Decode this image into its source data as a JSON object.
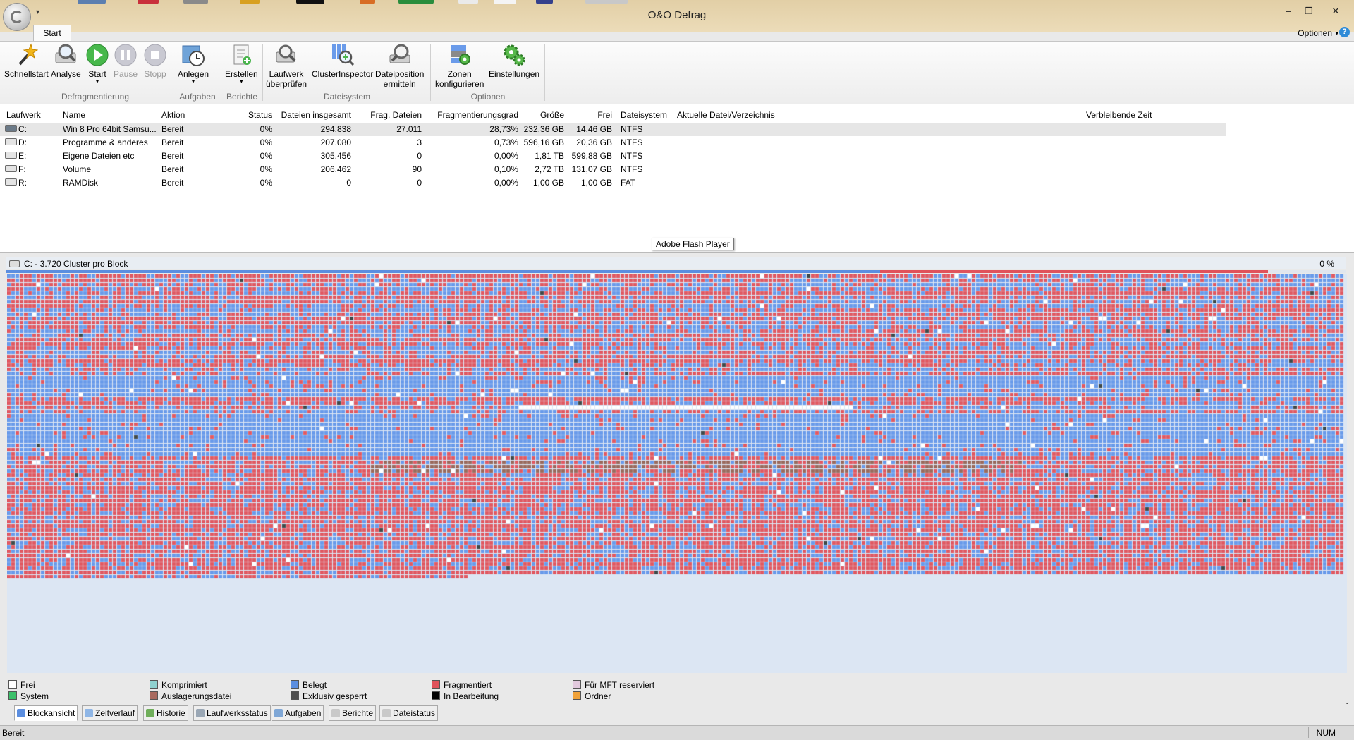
{
  "window": {
    "title": "O&O Defrag",
    "tab_start": "Start",
    "optionen": "Optionen",
    "help": "?",
    "minimize": "–",
    "restore": "❐",
    "close": "✕"
  },
  "ribbon": {
    "buttons": [
      {
        "label": "Schnellstart",
        "icon": "wand-icon"
      },
      {
        "label": "Analyse",
        "icon": "magnifier-icon"
      },
      {
        "label": "Start",
        "icon": "play-icon"
      },
      {
        "label": "Pause",
        "icon": "pause-icon",
        "disabled": true
      },
      {
        "label": "Stopp",
        "icon": "stop-icon",
        "disabled": true
      },
      {
        "label": "Anlegen",
        "icon": "clock-icon"
      },
      {
        "label": "Erstellen",
        "icon": "report-icon"
      },
      {
        "label": "Laufwerk überprüfen",
        "line1": "Laufwerk",
        "line2": "überprüfen",
        "icon": "drive-check-icon"
      },
      {
        "label": "ClusterInspector",
        "icon": "cluster-inspector-icon"
      },
      {
        "label": "Dateiposition ermitteln",
        "line1": "Dateiposition",
        "line2": "ermitteln",
        "icon": "file-search-icon"
      },
      {
        "label": "Zonen konfigurieren",
        "line1": "Zonen",
        "line2": "konfigurieren",
        "icon": "zones-icon"
      },
      {
        "label": "Einstellungen",
        "icon": "gears-icon"
      }
    ],
    "groups": [
      "Defragmentierung",
      "Aufgaben",
      "Berichte",
      "Dateisystem",
      "Optionen"
    ],
    "dropdown_glyph": "▾"
  },
  "drive_list": {
    "columns": [
      "Laufwerk",
      "Name",
      "Aktion",
      "Status",
      "Dateien insgesamt",
      "Frag. Dateien",
      "Fragmentierungsgrad",
      "Größe",
      "Frei",
      "Dateisystem",
      "Aktuelle Datei/Verzeichnis",
      "Verbleibende Zeit"
    ],
    "rows": [
      {
        "drive": "C:",
        "name": "Win 8 Pro 64bit Samsu...",
        "action": "Bereit",
        "status": "0%",
        "files": "294.838",
        "frag": "27.011",
        "degree": "28,73%",
        "size": "232,36 GB",
        "free": "14,46 GB",
        "fs": "NTFS",
        "selected": true
      },
      {
        "drive": "D:",
        "name": "Programme & anderes",
        "action": "Bereit",
        "status": "0%",
        "files": "207.080",
        "frag": "3",
        "degree": "0,73%",
        "size": "596,16 GB",
        "free": "20,36 GB",
        "fs": "NTFS"
      },
      {
        "drive": "E:",
        "name": "Eigene Dateien etc",
        "action": "Bereit",
        "status": "0%",
        "files": "305.456",
        "frag": "0",
        "degree": "0,00%",
        "size": "1,81 TB",
        "free": "599,88 GB",
        "fs": "NTFS"
      },
      {
        "drive": "F:",
        "name": "Volume",
        "action": "Bereit",
        "status": "0%",
        "files": "206.462",
        "frag": "90",
        "degree": "0,10%",
        "size": "2,72 TB",
        "free": "131,07 GB",
        "fs": "NTFS"
      },
      {
        "drive": "R:",
        "name": "RAMDisk",
        "action": "Bereit",
        "status": "0%",
        "files": "0",
        "frag": "0",
        "degree": "0,00%",
        "size": "1,00 GB",
        "free": "1,00 GB",
        "fs": "FAT"
      }
    ]
  },
  "tooltip": "Adobe Flash Player",
  "block_view": {
    "title": "C: - 3.720 Cluster pro Block",
    "percent": "0 %",
    "colors": {
      "fragmented": "#e05a63",
      "allocated": "#6a9bea",
      "free": "#ffffff",
      "system": "#9a6b5e",
      "locked": "#404a4a",
      "background": "#dce6f3"
    }
  },
  "legend": [
    {
      "label": "Frei",
      "color": "#ffffff"
    },
    {
      "label": "System",
      "color": "#3cc06a"
    },
    {
      "label": "Komprimiert",
      "color": "#8ed1cf"
    },
    {
      "label": "Auslagerungsdatei",
      "color": "#a8695e"
    },
    {
      "label": "Belegt",
      "color": "#5b8ee0"
    },
    {
      "label": "Exklusiv gesperrt",
      "color": "#4f4f4f"
    },
    {
      "label": "Fragmentiert",
      "color": "#e0525b"
    },
    {
      "label": "In Bearbeitung",
      "color": "#000000"
    },
    {
      "label": "Für MFT reserviert",
      "color": "#e2c9dd"
    },
    {
      "label": "Ordner",
      "color": "#f0a23a"
    }
  ],
  "bottom_tabs": [
    {
      "label": "Blockansicht",
      "icon": "grid-icon"
    },
    {
      "label": "Zeitverlauf",
      "icon": "chart-line-icon"
    },
    {
      "label": "Historie",
      "icon": "bar-chart-icon"
    },
    {
      "label": "Laufwerksstatus",
      "icon": "drive-status-icon"
    },
    {
      "label": "Aufgaben",
      "icon": "tasks-icon"
    },
    {
      "label": "Berichte",
      "icon": "reports-icon"
    },
    {
      "label": "Dateistatus",
      "icon": "file-status-icon"
    }
  ],
  "statusbar": {
    "text": "Bereit",
    "num": "NUM"
  }
}
